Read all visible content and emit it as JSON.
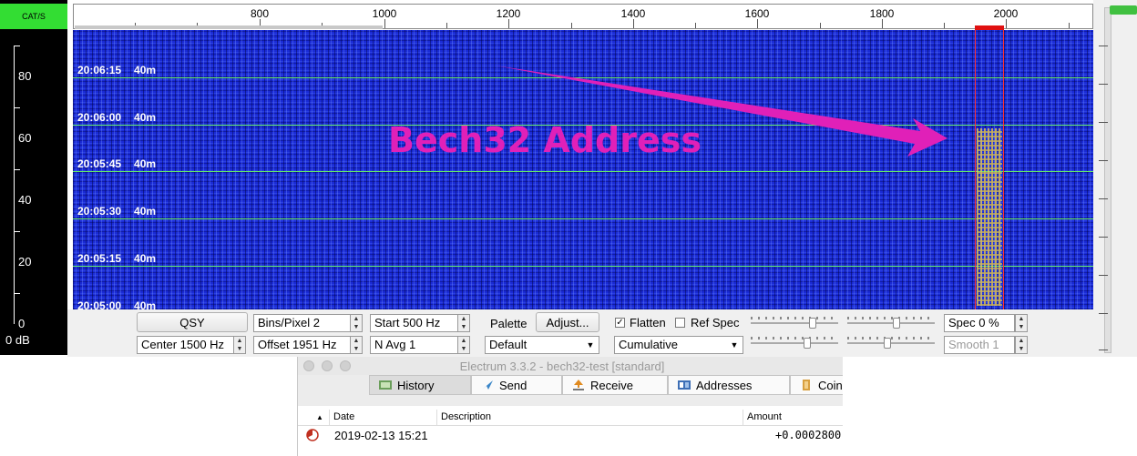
{
  "cat_button": "CAT/S",
  "db_scale": {
    "labels": [
      "80",
      "60",
      "40",
      "20",
      "0"
    ],
    "unit": "0 dB"
  },
  "frequency_scale": {
    "labels": [
      "800",
      "1000",
      "1200",
      "1400",
      "1600",
      "1800",
      "2000"
    ]
  },
  "waterfall": {
    "time_markers": [
      {
        "time": "20:06:15",
        "band": "40m"
      },
      {
        "time": "20:06:00",
        "band": "40m"
      },
      {
        "time": "20:05:45",
        "band": "40m"
      },
      {
        "time": "20:05:30",
        "band": "40m"
      },
      {
        "time": "20:05:15",
        "band": "40m"
      },
      {
        "time": "20:05:00",
        "band": "40m"
      }
    ],
    "annotation": "Bech32 Address",
    "colors": {
      "background": "#1a2bd6",
      "gridline": "#66ee66",
      "signal": "#e6c850",
      "marker": "#e01010",
      "annotation": "#e020b8"
    }
  },
  "controls": {
    "qsy": "QSY",
    "center": "Center 1500 Hz",
    "bins_pixel": "Bins/Pixel  2",
    "offset": "Offset 1951 Hz",
    "start": "Start 500 Hz",
    "n_avg": "N Avg 1",
    "palette": "Palette",
    "adjust": "Adjust...",
    "palette_value": "Default",
    "flatten": "Flatten",
    "flatten_checked": true,
    "ref_spec": "Ref Spec",
    "ref_spec_checked": false,
    "mode_value": "Cumulative",
    "spec": "Spec 0 %",
    "smooth": "Smooth  1"
  },
  "electrum": {
    "title": "Electrum 3.3.2  -  bech32-test  [standard]",
    "tabs": [
      {
        "label": "History",
        "icon": "history-icon",
        "selected": true
      },
      {
        "label": "Send",
        "icon": "send-icon",
        "selected": false
      },
      {
        "label": "Receive",
        "icon": "receive-icon",
        "selected": false
      },
      {
        "label": "Addresses",
        "icon": "addresses-icon",
        "selected": false
      },
      {
        "label": "Coin",
        "icon": "coins-icon",
        "selected": false
      }
    ],
    "columns": {
      "date": "Date",
      "description": "Description",
      "amount": "Amount"
    },
    "rows": [
      {
        "date": "2019-02-13 15:21",
        "description": "",
        "amount": "+0.0002800"
      }
    ]
  }
}
